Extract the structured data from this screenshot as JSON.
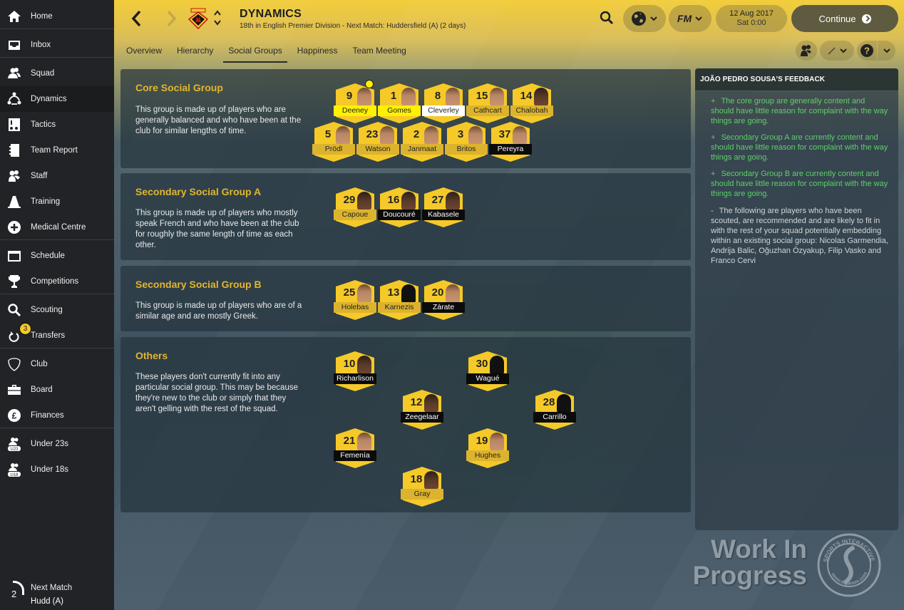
{
  "sidebar": {
    "items": [
      {
        "id": "home",
        "label": "Home",
        "icon": "home-icon"
      },
      {
        "id": "inbox",
        "label": "Inbox",
        "icon": "inbox-icon"
      },
      {
        "id": "squad",
        "label": "Squad",
        "icon": "squad-icon"
      },
      {
        "id": "dynamics",
        "label": "Dynamics",
        "icon": "dynamics-icon",
        "active": true
      },
      {
        "id": "tactics",
        "label": "Tactics",
        "icon": "tactics-icon"
      },
      {
        "id": "team-report",
        "label": "Team Report",
        "icon": "report-icon"
      },
      {
        "id": "staff",
        "label": "Staff",
        "icon": "staff-icon"
      },
      {
        "id": "training",
        "label": "Training",
        "icon": "cone-icon"
      },
      {
        "id": "medical-centre",
        "label": "Medical Centre",
        "icon": "medical-icon"
      },
      {
        "id": "schedule",
        "label": "Schedule",
        "icon": "calendar-icon"
      },
      {
        "id": "competitions",
        "label": "Competitions",
        "icon": "trophy-icon"
      },
      {
        "id": "scouting",
        "label": "Scouting",
        "icon": "search-icon"
      },
      {
        "id": "transfers",
        "label": "Transfers",
        "icon": "transfers-icon",
        "badge": "3"
      },
      {
        "id": "club",
        "label": "Club",
        "icon": "shield-icon"
      },
      {
        "id": "board",
        "label": "Board",
        "icon": "briefcase-icon"
      },
      {
        "id": "finances",
        "label": "Finances",
        "icon": "pound-icon"
      },
      {
        "id": "under-23s",
        "label": "Under 23s",
        "icon": "u23-icon"
      },
      {
        "id": "under-18s",
        "label": "Under 18s",
        "icon": "u18-icon"
      }
    ],
    "next_match": {
      "days": "2",
      "label": "Next Match",
      "opponent": "Hudd (A)"
    }
  },
  "header": {
    "title": "DYNAMICS",
    "subtitle": "18th in English Premier Division - Next Match: Huddersfield (A) (2 days)",
    "date": "12 Aug 2017",
    "time": "Sat 0:00",
    "continue_label": "Continue",
    "fm_label": "FM"
  },
  "tabs": [
    {
      "label": "Overview"
    },
    {
      "label": "Hierarchy"
    },
    {
      "label": "Social Groups",
      "active": true
    },
    {
      "label": "Happiness"
    },
    {
      "label": "Team Meeting"
    }
  ],
  "groups": [
    {
      "title": "Core Social Group",
      "description": "This group is made up of players who are generally balanced and who have been at the club for similar lengths of time.",
      "players": [
        {
          "number": "9",
          "name": "Deeney",
          "tag": "highlight",
          "captain": true
        },
        {
          "number": "1",
          "name": "Gomes",
          "tag": "highlight"
        },
        {
          "number": "8",
          "name": "Cleverley",
          "tag": "white"
        },
        {
          "number": "15",
          "name": "Cathcart",
          "tag": "gold"
        },
        {
          "number": "14",
          "name": "Chalobah",
          "tag": "gold"
        },
        {
          "number": "5",
          "name": "Prödl",
          "tag": "gold"
        },
        {
          "number": "23",
          "name": "Watson",
          "tag": "gold"
        },
        {
          "number": "2",
          "name": "Janmaat",
          "tag": "gold"
        },
        {
          "number": "3",
          "name": "Britos",
          "tag": "gold"
        },
        {
          "number": "37",
          "name": "Pereyra",
          "tag": "black"
        }
      ]
    },
    {
      "title": "Secondary Social Group A",
      "description": "This group is made up of players who mostly speak French and who have been at the club for roughly the same length of time as each other.",
      "players": [
        {
          "number": "29",
          "name": "Capoue",
          "tag": "gold"
        },
        {
          "number": "16",
          "name": "Doucouré",
          "tag": "black"
        },
        {
          "number": "27",
          "name": "Kabasele",
          "tag": "black"
        }
      ]
    },
    {
      "title": "Secondary Social Group B",
      "description": "This group is made up of players who are of a similar age and are mostly Greek.",
      "players": [
        {
          "number": "25",
          "name": "Holebas",
          "tag": "gold"
        },
        {
          "number": "13",
          "name": "Karnezis",
          "tag": "gold",
          "silhouette": true
        },
        {
          "number": "20",
          "name": "Zárate",
          "tag": "black"
        }
      ]
    },
    {
      "title": "Others",
      "description": "These players don't currently fit into any particular social group. This may be because they're new to the club or simply that they aren't gelling with the rest of the squad.",
      "players": [
        {
          "number": "10",
          "name": "Richarlison",
          "tag": "black"
        },
        {
          "number": "30",
          "name": "Wagué",
          "tag": "black",
          "silhouette": true
        },
        {
          "number": "12",
          "name": "Zeegelaar",
          "tag": "black"
        },
        {
          "number": "28",
          "name": "Carrillo",
          "tag": "black",
          "silhouette": true
        },
        {
          "number": "21",
          "name": "Femenía",
          "tag": "black"
        },
        {
          "number": "19",
          "name": "Hughes",
          "tag": "gold"
        },
        {
          "number": "18",
          "name": "Gray",
          "tag": "gold"
        }
      ]
    }
  ],
  "feedback": {
    "title": "JOÃO PEDRO SOUSA'S FEEDBACK",
    "items": [
      {
        "sign": "+",
        "type": "positive",
        "text": "The core group are generally content and should have little reason for complaint with the way things are going."
      },
      {
        "sign": "+",
        "type": "positive",
        "text": "Secondary Group A are currently content and should have little reason for complaint with the way things are going."
      },
      {
        "sign": "+",
        "type": "positive",
        "text": "Secondary Group B are currently content and should have little reason for complaint with the way things are going."
      },
      {
        "sign": "-",
        "type": "neutral",
        "text": "The following are players who have been scouted, are recommended and are likely to fit in with the rest of your squad potentially embedding within an existing social group: Nicolas Garmendia, Andrija Balic, Oğuzhan Özyakup, Filip Vasko and Franco Cervi"
      }
    ]
  },
  "watermark": {
    "line1": "Work In",
    "line2": "Progress",
    "logo_top": "SPORTS INTERACTIVE",
    "logo_bottom": "www.sigames.com"
  }
}
